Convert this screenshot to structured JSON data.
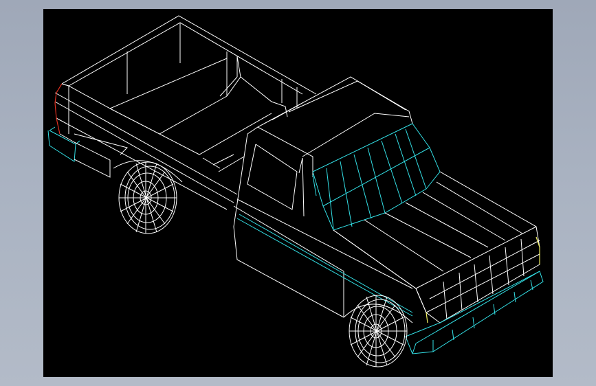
{
  "window": {
    "background_color": "#a7b0bf",
    "viewport_color": "#000000"
  },
  "model": {
    "icon": "pickup-truck-wireframe-icon",
    "colors": {
      "edges": "#ffffff",
      "highlight_edges": "#33e0e6",
      "tail_accent": "#e03020",
      "front_accent": "#f0f060"
    }
  }
}
